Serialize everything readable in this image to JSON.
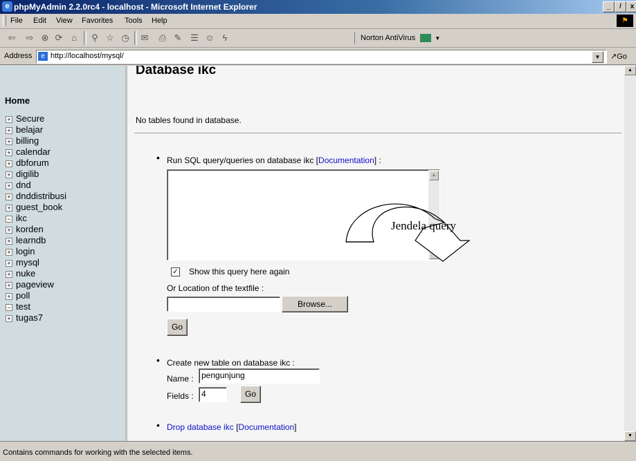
{
  "window": {
    "title": "phpMyAdmin 2.2.0rc4 - localhost - Microsoft Internet Explorer",
    "min": "_",
    "restore": "̸",
    "close": "x"
  },
  "menu": [
    "File",
    "Edit",
    "View",
    "Favorites",
    "Tools",
    "Help"
  ],
  "toolbar": {
    "icons": [
      "back-icon",
      "forward-icon",
      "stop-icon",
      "refresh-icon",
      "home-icon",
      "search-icon",
      "favorites-icon",
      "history-icon",
      "mail-icon",
      "print-icon",
      "edit-icon",
      "discuss-icon",
      "messenger-icon",
      "norton-antivirus-icon"
    ],
    "norton_label": "Norton AntiVirus"
  },
  "address": {
    "label": "Address",
    "url": "http://localhost/mysql/",
    "go_label": "Go"
  },
  "sidebar": {
    "home_label": "Home",
    "databases": [
      {
        "name": "Secure",
        "expanded": false
      },
      {
        "name": "belajar",
        "expanded": false
      },
      {
        "name": "billing",
        "expanded": false
      },
      {
        "name": "calendar",
        "expanded": false
      },
      {
        "name": "dbforum",
        "expanded": false
      },
      {
        "name": "digilib",
        "expanded": false
      },
      {
        "name": "dnd",
        "expanded": false
      },
      {
        "name": "dnddistribusi",
        "expanded": false
      },
      {
        "name": "guest_book",
        "expanded": false
      },
      {
        "name": "ikc",
        "expanded": true
      },
      {
        "name": "korden",
        "expanded": false
      },
      {
        "name": "learndb",
        "expanded": false
      },
      {
        "name": "login",
        "expanded": false
      },
      {
        "name": "mysql",
        "expanded": false
      },
      {
        "name": "nuke",
        "expanded": false
      },
      {
        "name": "pageview",
        "expanded": false
      },
      {
        "name": "poll",
        "expanded": false
      },
      {
        "name": "test",
        "expanded": true
      },
      {
        "name": "tugas7",
        "expanded": false
      }
    ]
  },
  "main": {
    "title": "Database ikc",
    "no_tables": "No tables found in database.",
    "sql": {
      "label": "Run SQL query/queries on database ikc [",
      "doc_link": "Documentation",
      "label_end": "] :",
      "query_value": "",
      "show_again_checked": true,
      "show_again_label": "Show this query here again",
      "location_label": "Or Location of the textfile :",
      "file_value": "",
      "browse_label": "Browse...",
      "go_label": "Go"
    },
    "create": {
      "label": "Create new table on database ikc :",
      "name_label": "Name :",
      "name_value": "pengunjung",
      "fields_label": "Fields :",
      "fields_value": "4",
      "go_label": "Go"
    },
    "drop": {
      "link": "Drop database ikc",
      "open": " [",
      "doc_link": "Documentation",
      "close": "]"
    }
  },
  "annotation": {
    "text": "Jendela query"
  },
  "status": {
    "text": "Contains commands for working with the selected items."
  },
  "colors": {
    "link": "#1010cc",
    "left_frame": "#d0dce0",
    "titlebar": "#0a246a"
  }
}
